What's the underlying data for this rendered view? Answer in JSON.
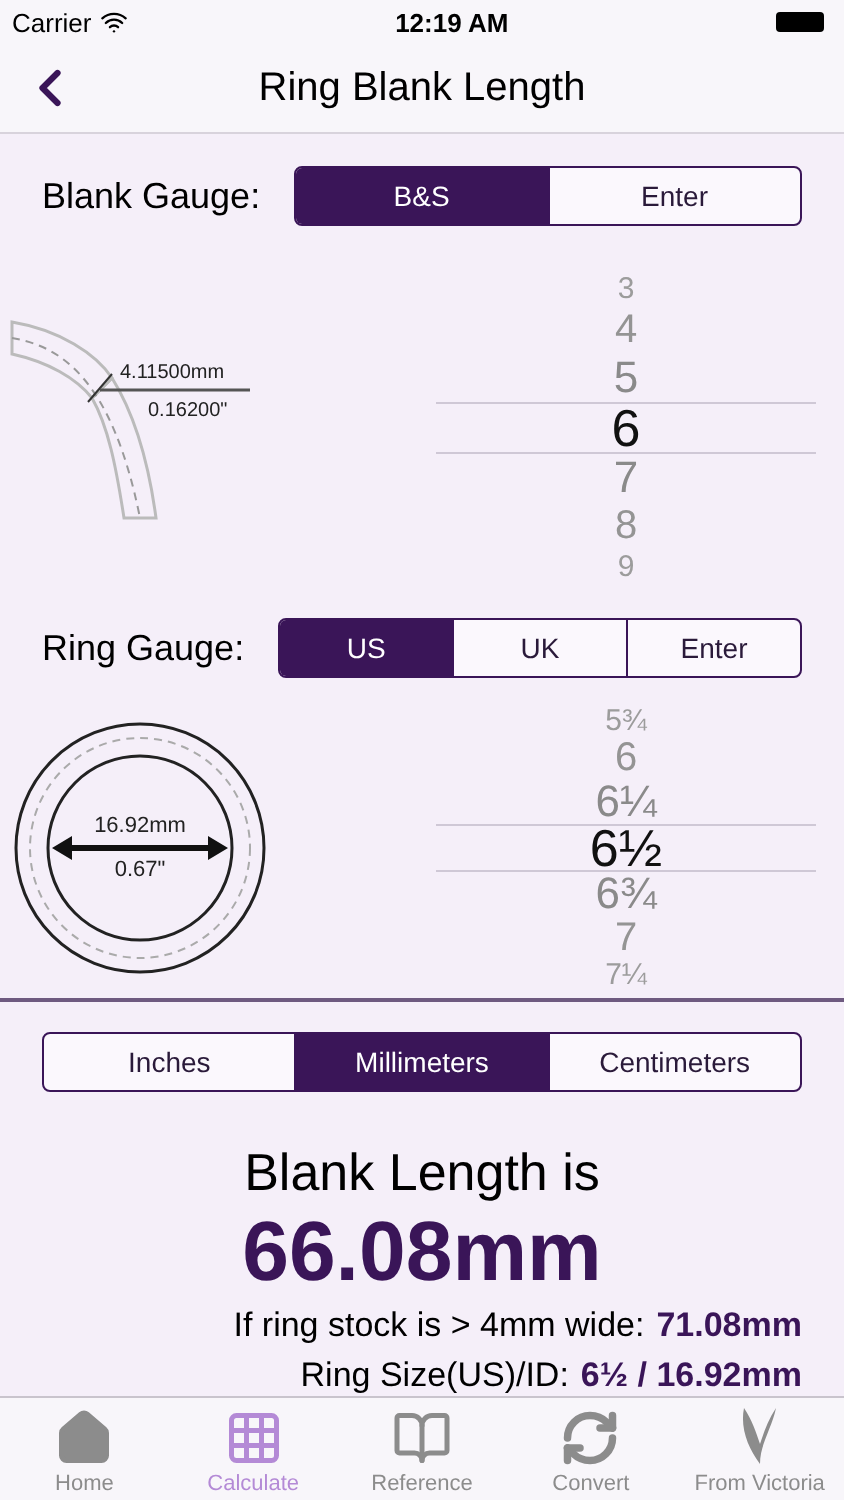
{
  "status_bar": {
    "carrier": "Carrier",
    "time": "12:19 AM"
  },
  "nav": {
    "title": "Ring Blank Length"
  },
  "blank_gauge": {
    "label": "Blank Gauge:",
    "options": [
      {
        "label": "B&S",
        "selected": true
      },
      {
        "label": "Enter",
        "selected": false
      }
    ],
    "diagram": {
      "width": "4.11500mm",
      "thickness": "0.16200\""
    },
    "picker": [
      {
        "label": "3",
        "selected": false
      },
      {
        "label": "4",
        "selected": false
      },
      {
        "label": "5",
        "selected": false
      },
      {
        "label": "6",
        "selected": true
      },
      {
        "label": "7",
        "selected": false
      },
      {
        "label": "8",
        "selected": false
      },
      {
        "label": "9",
        "selected": false
      }
    ]
  },
  "ring_gauge": {
    "label": "Ring Gauge:",
    "options": [
      {
        "label": "US",
        "selected": true
      },
      {
        "label": "UK",
        "selected": false
      },
      {
        "label": "Enter",
        "selected": false
      }
    ],
    "diagram": {
      "diameter_mm": "16.92mm",
      "diameter_in": "0.67\""
    },
    "picker": [
      {
        "label": "5¾",
        "selected": false
      },
      {
        "label": "6",
        "selected": false
      },
      {
        "label": "6¼",
        "selected": false
      },
      {
        "label": "6½",
        "selected": true
      },
      {
        "label": "6¾",
        "selected": false
      },
      {
        "label": "7",
        "selected": false
      },
      {
        "label": "7¼",
        "selected": false
      }
    ]
  },
  "units": [
    {
      "label": "Inches",
      "selected": false
    },
    {
      "label": "Millimeters",
      "selected": true
    },
    {
      "label": "Centimeters",
      "selected": false
    }
  ],
  "result": {
    "heading": "Blank Length is",
    "value": "66.08mm",
    "details": [
      {
        "label": "If ring stock is > 4mm wide:",
        "value": "71.08mm"
      },
      {
        "label": "Ring Size(US)/ID:",
        "value": "6½ / 16.92mm"
      }
    ]
  },
  "tab_bar": [
    {
      "kind": "home",
      "label": "Home",
      "selected": false
    },
    {
      "kind": "grid",
      "label": "Calculate",
      "selected": true
    },
    {
      "kind": "book",
      "label": "Reference",
      "selected": false
    },
    {
      "kind": "convert",
      "label": "Convert",
      "selected": false
    },
    {
      "kind": "logo",
      "label": "From Victoria",
      "selected": false
    }
  ]
}
